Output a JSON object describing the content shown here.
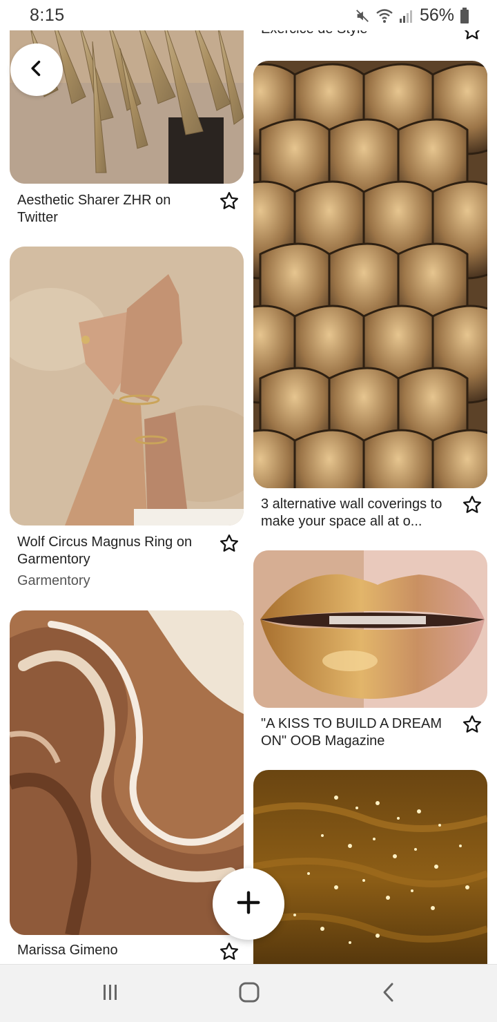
{
  "status_bar": {
    "time": "8:15",
    "battery": "56%",
    "icons": [
      "mute-icon",
      "wifi-icon",
      "signal-icon",
      "battery-icon"
    ]
  },
  "feed": {
    "pins_left": [
      {
        "title": "Aesthetic Sharer ZHR on Twitter",
        "subtitle": ""
      },
      {
        "title": "Wolf Circus Magnus Ring on Garmentory",
        "subtitle": "Garmentory"
      },
      {
        "title": "Marissa Gimeno",
        "subtitle": ""
      }
    ],
    "pins_right": [
      {
        "title": "Exercice de Style",
        "subtitle": ""
      },
      {
        "title": "3 alternative wall coverings to make your space all at o...",
        "subtitle": ""
      },
      {
        "title": "\"A KISS TO BUILD A DREAM ON\" OOB Magazine",
        "subtitle": ""
      },
      {
        "title": "",
        "subtitle": ""
      }
    ]
  },
  "actions": {
    "back_icon": "chevron-left-icon",
    "add_icon": "plus-icon",
    "save_icon": "star-icon"
  },
  "nav_bar": {
    "items": [
      "recent-apps-icon",
      "home-icon",
      "back-icon"
    ]
  },
  "colors": {
    "gold": "#b08a55",
    "gold_dark": "#6b4a25",
    "nav_bg": "#f2f2f2"
  }
}
